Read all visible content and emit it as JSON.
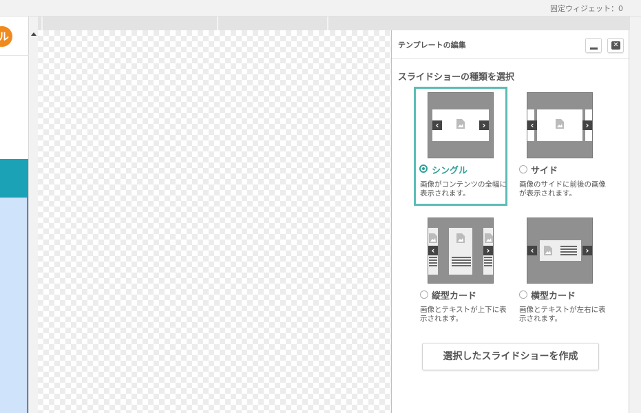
{
  "topbar": {
    "fixed_widget": "固定ウィジェット：0"
  },
  "left_panel": {
    "badge_text": "ル"
  },
  "dialog": {
    "title": "テンプレートの編集",
    "section_title": "スライドショーの種類を選択",
    "options": [
      {
        "label": "シングル",
        "description": "画像がコンテンツの全幅に表示されます。",
        "selected": true
      },
      {
        "label": "サイド",
        "description": "画像のサイドに前後の画像が表示されます。",
        "selected": false
      },
      {
        "label": "縦型カード",
        "description": "画像とテキストが上下に表示されます。",
        "selected": false
      },
      {
        "label": "横型カード",
        "description": "画像とテキストが左右に表示されます。",
        "selected": false
      }
    ],
    "create_button": "選択したスライドショーを作成"
  },
  "colors": {
    "accent": "#2f9f99",
    "selection_border": "#5cbcb6",
    "teal_band": "#1ba2b6",
    "badge": "#f08a1c",
    "light_blue": "#cfe3fb"
  },
  "icons": {
    "minimize": "minimize-icon",
    "close": "close-icon",
    "prev": "chevron-left-icon",
    "next": "chevron-right-icon",
    "image": "image-icon"
  }
}
